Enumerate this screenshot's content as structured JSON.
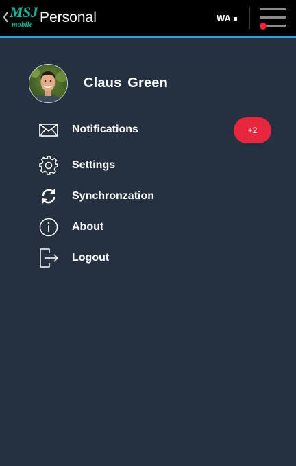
{
  "header": {
    "logo_main": "MSJ",
    "logo_sub": "mobile",
    "title": "Personal",
    "status_label": "WA",
    "menu_icon": "hamburger-menu-icon",
    "back_icon": "chevron-left-icon"
  },
  "profile": {
    "name": "Claus  Green",
    "avatar_icon": "user-avatar-photo"
  },
  "menu": {
    "items": [
      {
        "label": "Notifications",
        "icon": "envelope-icon"
      },
      {
        "label": "Settings",
        "icon": "gear-icon"
      },
      {
        "label": "Synchronzation",
        "icon": "sync-icon"
      },
      {
        "label": "About",
        "icon": "info-icon"
      },
      {
        "label": "Logout",
        "icon": "logout-icon"
      }
    ],
    "notifications_badge": "+2"
  },
  "colors": {
    "background": "#253140",
    "appbar": "#000000",
    "appbar_accent": "#3a9fd3",
    "brand": "#19b39c",
    "badge": "#e8273f"
  }
}
